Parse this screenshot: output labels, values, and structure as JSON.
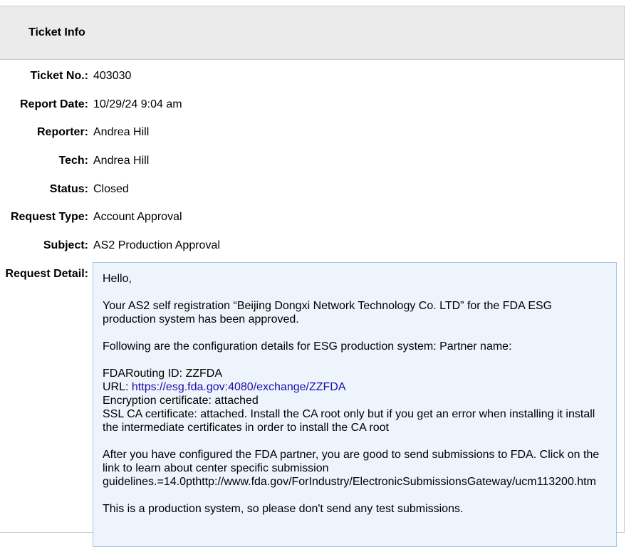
{
  "header": {
    "title": "Ticket Info"
  },
  "fields": {
    "ticket_no": {
      "label": "Ticket No.:",
      "value": "403030"
    },
    "report_date": {
      "label": "Report Date:",
      "value": "10/29/24 9:04 am"
    },
    "reporter": {
      "label": "Reporter:",
      "value": "Andrea Hill"
    },
    "tech": {
      "label": "Tech:",
      "value": "Andrea Hill"
    },
    "status": {
      "label": "Status:",
      "value": "Closed"
    },
    "request_type": {
      "label": "Request Type:",
      "value": "Account Approval"
    },
    "subject": {
      "label": "Subject:",
      "value": "AS2 Production Approval"
    },
    "request_detail": {
      "label": "Request Detail:"
    }
  },
  "detail": {
    "greeting": "Hello,",
    "line1": "Your AS2 self registration “Beijing Dongxi Network Technology Co. LTD” for the FDA ESG production system has been approved.",
    "line2": "Following are the configuration details for ESG production system: Partner name:",
    "routing": "FDARouting ID: ZZFDA",
    "url_label": "URL: ",
    "url_link": "https://esg.fda.gov:4080/exchange/ZZFDA",
    "encryption": "Encryption certificate: attached",
    "ssl": "SSL CA certificate: attached. Install the CA root only but if you get an error when installing it install the intermediate certificates in order to install the CA root",
    "line3": "After you have configured the FDA partner, you are good to send submissions to FDA. Click on the link to learn about center specific submission guidelines.=14.0pthttp://www.fda.gov/ForIndustry/ElectronicSubmissionsGateway/ucm113200.htm",
    "line4": "This is a production system, so please don't send any test submissions."
  },
  "colors": {
    "header_bg": "#ebebeb",
    "detail_bg": "#eef4fc",
    "detail_border": "#a9c3e2",
    "link": "#1a0dab"
  }
}
